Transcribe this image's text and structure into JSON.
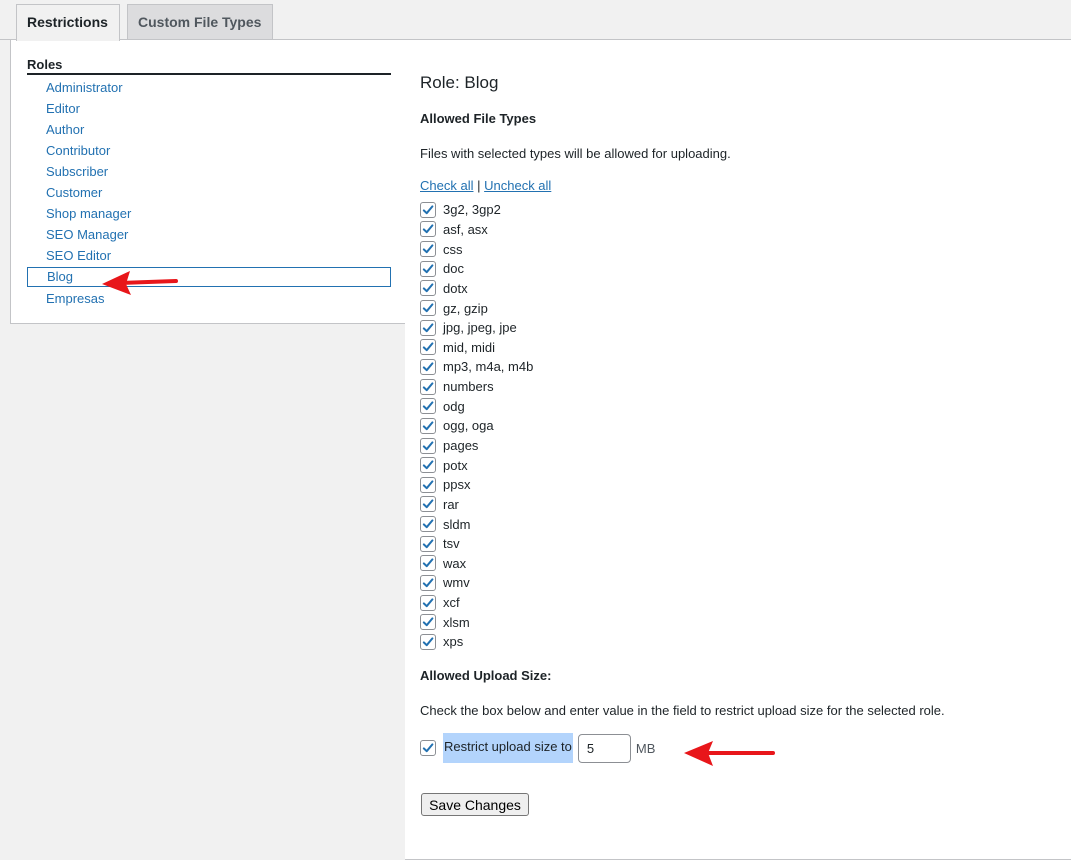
{
  "tabs": {
    "restrictions": "Restrictions",
    "custom_file_types": "Custom File Types"
  },
  "roles": {
    "title": "Roles",
    "items": [
      {
        "label": "Administrator"
      },
      {
        "label": "Editor"
      },
      {
        "label": "Author"
      },
      {
        "label": "Contributor"
      },
      {
        "label": "Subscriber"
      },
      {
        "label": "Customer"
      },
      {
        "label": "Shop manager"
      },
      {
        "label": "SEO Manager"
      },
      {
        "label": "SEO Editor"
      },
      {
        "label": "Blog",
        "selected": true
      },
      {
        "label": "Empresas"
      }
    ]
  },
  "main": {
    "heading": "Role: Blog",
    "allowed_types_label": "Allowed File Types",
    "allowed_types_desc": "Files with selected types will be allowed for uploading.",
    "check_all": "Check all",
    "separator": "|",
    "uncheck_all": "Uncheck all",
    "file_types": [
      {
        "label": "3g2, 3gp2",
        "checked": true
      },
      {
        "label": "asf, asx",
        "checked": true
      },
      {
        "label": "css",
        "checked": true
      },
      {
        "label": "doc",
        "checked": true
      },
      {
        "label": "dotx",
        "checked": true
      },
      {
        "label": "gz, gzip",
        "checked": true
      },
      {
        "label": "jpg, jpeg, jpe",
        "checked": true
      },
      {
        "label": "mid, midi",
        "checked": true
      },
      {
        "label": "mp3, m4a, m4b",
        "checked": true
      },
      {
        "label": "numbers",
        "checked": true
      },
      {
        "label": "odg",
        "checked": true
      },
      {
        "label": "ogg, oga",
        "checked": true
      },
      {
        "label": "pages",
        "checked": true
      },
      {
        "label": "potx",
        "checked": true
      },
      {
        "label": "ppsx",
        "checked": true
      },
      {
        "label": "rar",
        "checked": true
      },
      {
        "label": "sldm",
        "checked": true
      },
      {
        "label": "tsv",
        "checked": true
      },
      {
        "label": "wax",
        "checked": true
      },
      {
        "label": "wmv",
        "checked": true
      },
      {
        "label": "xcf",
        "checked": true
      },
      {
        "label": "xlsm",
        "checked": true
      },
      {
        "label": "xps",
        "checked": true
      }
    ],
    "upload_size_label": "Allowed Upload Size:",
    "upload_size_desc": "Check the box below and enter value in the field to restrict upload size for the selected role.",
    "restrict_checked": true,
    "restrict_label": "Restrict upload size to",
    "size_value": "5",
    "size_unit": "MB",
    "save_button": "Save Changes"
  },
  "colors": {
    "link": "#2271b1",
    "annotation_arrow": "#e8161a",
    "selection_highlight": "#b3d4fc"
  }
}
